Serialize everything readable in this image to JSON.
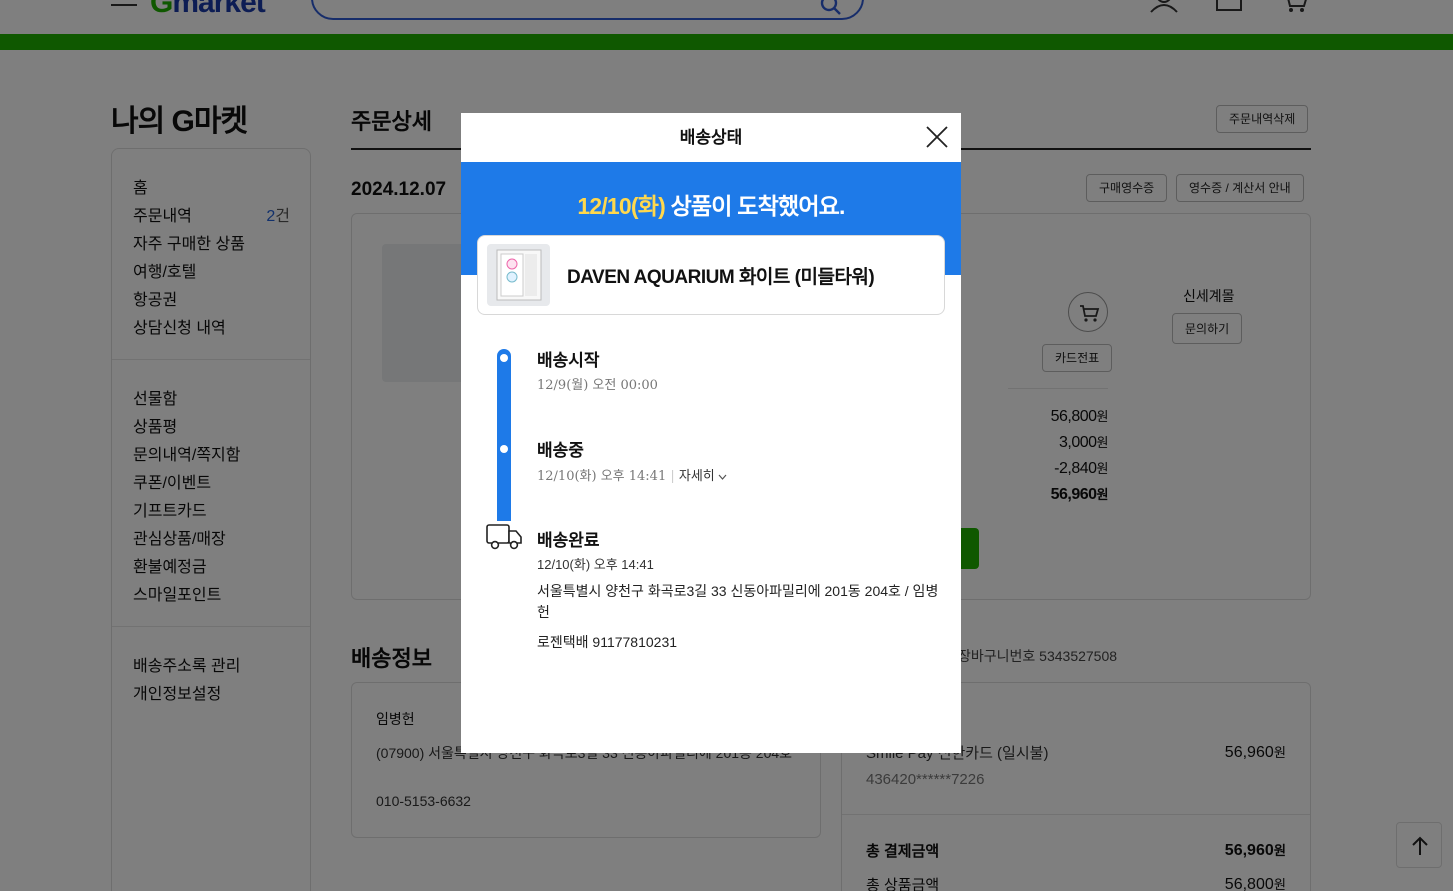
{
  "header": {
    "logo_prefix": "G",
    "logo_text": "market"
  },
  "sidebar": {
    "title": "나의 G마켓",
    "group1": [
      {
        "label": "홈"
      },
      {
        "label": "주문내역",
        "count": "2",
        "count_unit": "건"
      },
      {
        "label": "자주 구매한 상품"
      },
      {
        "label": "여행/호텔"
      },
      {
        "label": "항공권"
      },
      {
        "label": "상담신청 내역"
      }
    ],
    "group2": [
      {
        "label": "선물함"
      },
      {
        "label": "상품평"
      },
      {
        "label": "문의내역/쪽지함"
      },
      {
        "label": "쿠폰/이벤트"
      },
      {
        "label": "기프트카드"
      },
      {
        "label": "관심상품/매장"
      },
      {
        "label": "환불예정금"
      },
      {
        "label": "스마일포인트"
      }
    ],
    "group3": [
      {
        "label": "배송주소록 관리"
      },
      {
        "label": "개인정보설정"
      }
    ]
  },
  "main": {
    "page_title": "주문상세",
    "delete_button": "주문내역삭제",
    "order_date": "2024.12.07",
    "receipt_button": "구매영수증",
    "tax_button": "영수증 / 계산서 안내",
    "seller": "신세계몰",
    "inquiry_button": "문의하기",
    "card_slip_button": "카드전표",
    "prices": [
      {
        "amount": "56,800",
        "unit": "원",
        "bold": false
      },
      {
        "amount": "3,000",
        "unit": "원",
        "bold": false
      },
      {
        "amount": "-2,840",
        "unit": "원",
        "bold": false
      },
      {
        "amount": "56,960",
        "unit": "원",
        "bold": true
      }
    ],
    "shipping_section_title": "배송정보",
    "cart_number": "장바구니번호 5343527508",
    "ship_name": "임병헌",
    "ship_address": "(07900) 서울특별시 양천구 화곡로3길 33 신동아파밀리에 201동 204호",
    "ship_phone": "010-5153-6632",
    "pay_method": "Smile Pay 신한카드 (일시불)",
    "pay_card_number": "436420******7226",
    "pay_amount": "56,960",
    "pay_total_label": "총 결제금액",
    "pay_total": "56,960",
    "pay_sub_label": "총 상품금액",
    "pay_sub": "56,800",
    "unit": "원"
  },
  "modal": {
    "title": "배송상태",
    "banner_date": "12/10(화)",
    "banner_text": " 상품이 도착했어요.",
    "product_name": "DAVEN AQUARIUM 화이트 (미들타워)",
    "steps": [
      {
        "title": "배송시작",
        "time": "12/9(월) 오전 00:00"
      },
      {
        "title": "배송중",
        "time": "12/10(화) 오후 14:41",
        "detail_label": "자세히"
      },
      {
        "title": "배송완료",
        "time": "12/10(화) 오후 14:41"
      }
    ],
    "address": "서울특별시 양천구 화곡로3길 33 신동아파밀리에 201동 204호 / 임병헌",
    "courier": "로젠택배 91177810231"
  },
  "colors": {
    "brand_green": "#1fb000",
    "accent_blue": "#1e7ae8",
    "highlight_yellow": "#ffd84d"
  }
}
